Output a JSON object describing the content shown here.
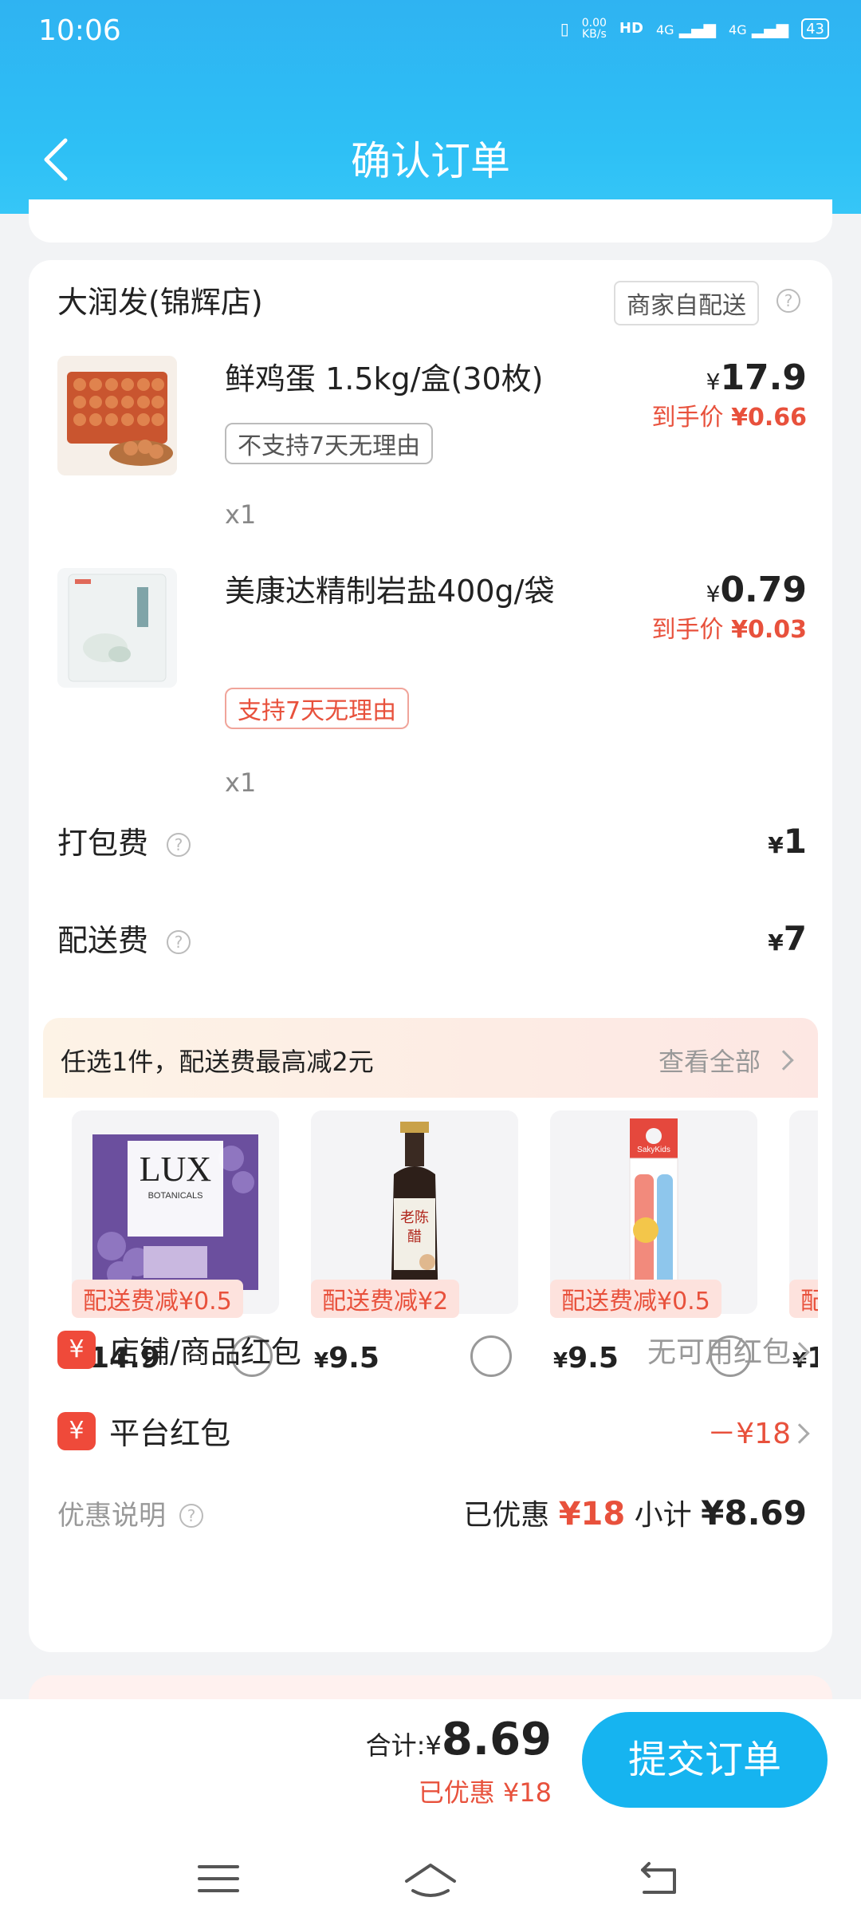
{
  "status_bar": {
    "time": "10:06",
    "net_speed": "0.00\nKB/s",
    "hd": "HD",
    "sig1": "4G",
    "sig2": "4G",
    "battery": "43"
  },
  "header": {
    "title": "确认订单"
  },
  "shop": {
    "name": "大润发(锦辉店)",
    "delivery": "商家自配送"
  },
  "items": [
    {
      "name": "鲜鸡蛋 1.5kg/盒(30枚)",
      "policy": "不支持7天无理由",
      "qty": "x1",
      "currency": "¥",
      "price": "17.9",
      "hand_label": "到手价",
      "hand_price": "¥0.66"
    },
    {
      "name": "美康达精制岩盐400g/袋",
      "policy": "支持7天无理由",
      "qty": "x1",
      "currency": "¥",
      "price": "0.79",
      "hand_label": "到手价",
      "hand_price": "¥0.03"
    }
  ],
  "fees": {
    "packing_label": "打包费",
    "packing_value": "1",
    "delivery_label": "配送费",
    "delivery_value": "7",
    "currency": "¥"
  },
  "promo": {
    "title": "任选1件，配送费最高减2元",
    "more": "查看全部",
    "products": [
      {
        "tag": "配送费减¥0.5",
        "price": "14.9"
      },
      {
        "tag": "配送费减¥2",
        "price": "9.5"
      },
      {
        "tag": "配送费减¥0.5",
        "price": "9.5"
      },
      {
        "tag": "配",
        "price": "1"
      }
    ],
    "currency": "¥"
  },
  "redpacks": {
    "icon_glyph": "¥",
    "shop_label": "店铺/商品红包",
    "shop_value": "无可用红包",
    "platform_label": "平台红包",
    "platform_value": "－¥18"
  },
  "summary": {
    "label": "优惠说明",
    "saved_label": "已优惠",
    "saved_value": "¥18",
    "subtotal_label": "小计",
    "subtotal_value": "¥8.69"
  },
  "bottom": {
    "total_label": "合计:",
    "currency": "¥",
    "total_value": "8.69",
    "saved": "已优惠 ¥18",
    "submit": "提交订单"
  },
  "colors": {
    "header": "#2fb3f2",
    "accent_red": "#e8513c",
    "submit_blue": "#16b4f0"
  }
}
